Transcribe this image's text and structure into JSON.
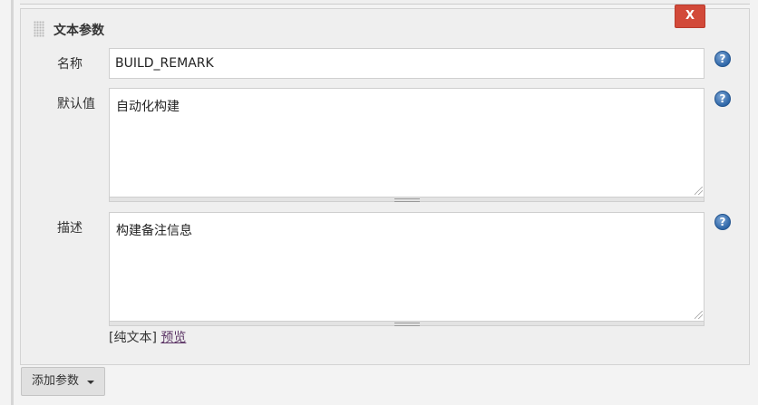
{
  "section": {
    "title": "文本参数",
    "delete_label": "X"
  },
  "fields": {
    "name": {
      "label": "名称",
      "value": "BUILD_REMARK"
    },
    "default": {
      "label": "默认值",
      "value": "自动化构建"
    },
    "description": {
      "label": "描述",
      "value": "构建备注信息"
    }
  },
  "markup": {
    "mode_text": "[纯文本]",
    "preview_label": "预览"
  },
  "add_param": {
    "label": "添加参数"
  },
  "icons": {
    "help": "help-icon",
    "drag": "drag-handle-icon",
    "dropdown": "caret-down-icon"
  },
  "colors": {
    "delete_button": "#d24939",
    "help_icon": "#2f67a8",
    "link": "#5c3566"
  }
}
